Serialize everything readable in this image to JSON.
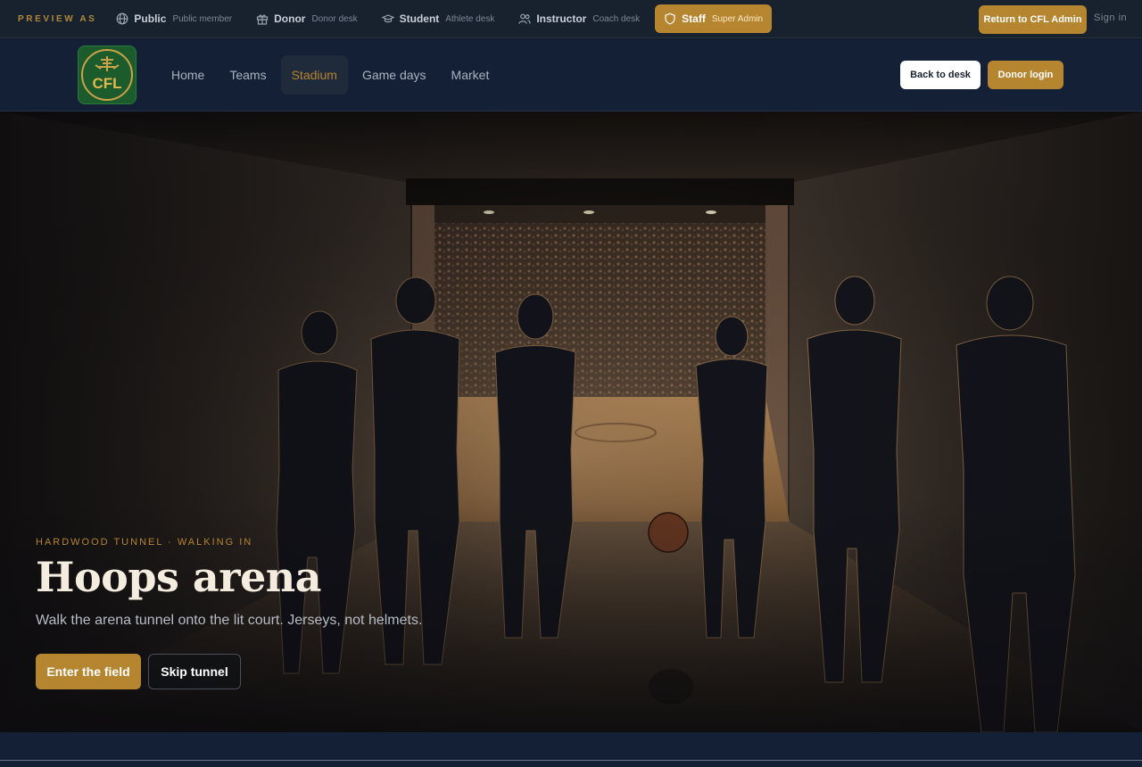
{
  "preview": {
    "label": "PREVIEW AS",
    "roles": [
      {
        "name": "Public",
        "sub": "Public member",
        "icon": "globe-icon"
      },
      {
        "name": "Donor",
        "sub": "Donor desk",
        "icon": "gift-icon"
      },
      {
        "name": "Student",
        "sub": "Athlete desk",
        "icon": "graduation-cap-icon"
      },
      {
        "name": "Instructor",
        "sub": "Coach desk",
        "icon": "users-icon"
      },
      {
        "name": "Staff",
        "sub": "Super Admin",
        "icon": "shield-icon",
        "active": true
      }
    ],
    "return_label": "Return to CFL Admin",
    "signin_label": "Sign in"
  },
  "nav": {
    "logo_text": "CFL",
    "links": [
      "Home",
      "Teams",
      "Stadium",
      "Game days",
      "Market"
    ],
    "active_link": "Stadium",
    "back_label": "Back to desk",
    "donor_label": "Donor login"
  },
  "hero": {
    "eyebrow": "HARDWOOD TUNNEL · WALKING IN",
    "title": "Hoops arena",
    "subtitle": "Walk the arena tunnel onto the lit court. Jerseys, not helmets.",
    "primary_cta": "Enter the field",
    "secondary_cta": "Skip tunnel"
  },
  "colors": {
    "accent": "#b5852f",
    "bg": "#0f1a2b",
    "nav": "#142035",
    "logo_green": "#1c5b2c"
  }
}
